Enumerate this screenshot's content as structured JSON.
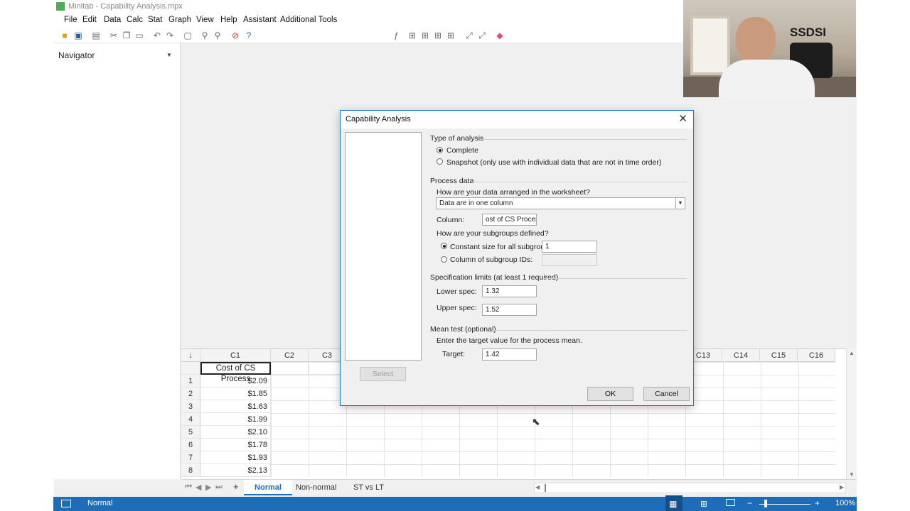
{
  "window": {
    "title": "Minitab - Capability Analysis.mpx"
  },
  "menu": [
    "File",
    "Edit",
    "Data",
    "Calc",
    "Stat",
    "Graph",
    "View",
    "Help",
    "Assistant",
    "Additional Tools"
  ],
  "navigator": {
    "title": "Navigator"
  },
  "worksheet": {
    "columns": [
      "C1",
      "C2",
      "C3",
      "C13",
      "C14",
      "C15",
      "C16"
    ],
    "column_names": {
      "C1": "Cost of CS Process"
    },
    "rows": [
      {
        "n": "1",
        "c1": "$2.09"
      },
      {
        "n": "2",
        "c1": "$1.85"
      },
      {
        "n": "3",
        "c1": "$1.63"
      },
      {
        "n": "4",
        "c1": "$1.99"
      },
      {
        "n": "5",
        "c1": "$2.10"
      },
      {
        "n": "6",
        "c1": "$1.78"
      },
      {
        "n": "7",
        "c1": "$1.93"
      },
      {
        "n": "8",
        "c1": "$2.13"
      }
    ]
  },
  "sheet_tabs": [
    "Normal",
    "Non-normal",
    "ST vs LT"
  ],
  "active_tab": "Normal",
  "statusbar": {
    "mode": "Normal",
    "zoom": "100%"
  },
  "dialog": {
    "title": "Capability Analysis",
    "type_of_analysis": {
      "heading": "Type of analysis",
      "options": [
        "Complete",
        "Snapshot (only use with individual data that are not in time order)"
      ],
      "selected": "Complete"
    },
    "process_data": {
      "heading": "Process data",
      "arrangement_label": "How are your data arranged in the worksheet?",
      "arrangement_value": "Data are in one column",
      "column_label": "Column:",
      "column_value": "'Cost of CS Process'",
      "column_visible": "ost of CS Process'",
      "subgroups_label": "How are your subgroups defined?",
      "constant_size_label": "Constant size for all subgroups:",
      "constant_size_value": "1",
      "subgroup_ids_label": "Column of subgroup IDs:"
    },
    "spec_limits": {
      "heading": "Specification limits (at least 1 required)",
      "lower_label": "Lower spec:",
      "lower_value": "1.32",
      "upper_label": "Upper spec:",
      "upper_value": "1.52"
    },
    "mean_test": {
      "heading": "Mean test (optional)",
      "instruction": "Enter the target value for the process mean.",
      "target_label": "Target:",
      "target_value": "1.42"
    },
    "buttons": {
      "select": "Select",
      "ok": "OK",
      "cancel": "Cancel"
    }
  },
  "webcam": {
    "wall_logo": "SSDSI"
  },
  "colors": {
    "accent": "#1e6db8",
    "dialog_border": "#1a73c7"
  }
}
